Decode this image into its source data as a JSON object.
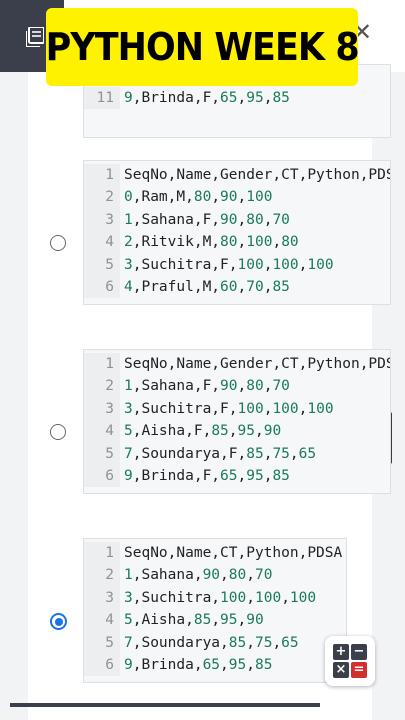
{
  "banner": {
    "title": "PYTHON WEEK 8"
  },
  "icons": {
    "document": "document-icon",
    "close": "close-icon",
    "calculator": "calculator-icon"
  },
  "colors": {
    "banner_bg": "#fff200",
    "radio_selected": "#1a73e8",
    "number": "#1a7a5a"
  },
  "blocks": [
    {
      "lines": [
        {
          "n": "11",
          "text": "9,Brinda,F,65,95,85"
        }
      ]
    },
    {
      "selected": false,
      "lines": [
        {
          "n": "1",
          "text": "SeqNo,Name,Gender,CT,Python,PDS"
        },
        {
          "n": "2",
          "text": "0,Ram,M,80,90,100"
        },
        {
          "n": "3",
          "text": "1,Sahana,F,90,80,70"
        },
        {
          "n": "4",
          "text": "2,Ritvik,M,80,100,80"
        },
        {
          "n": "5",
          "text": "3,Suchitra,F,100,100,100"
        },
        {
          "n": "6",
          "text": "4,Praful,M,60,70,85"
        }
      ]
    },
    {
      "selected": false,
      "lines": [
        {
          "n": "1",
          "text": "SeqNo,Name,Gender,CT,Python,PDS"
        },
        {
          "n": "2",
          "text": "1,Sahana,F,90,80,70"
        },
        {
          "n": "3",
          "text": "3,Suchitra,F,100,100,100"
        },
        {
          "n": "4",
          "text": "5,Aisha,F,85,95,90"
        },
        {
          "n": "5",
          "text": "7,Soundarya,F,85,75,65"
        },
        {
          "n": "6",
          "text": "9,Brinda,F,65,95,85"
        }
      ]
    },
    {
      "selected": true,
      "lines": [
        {
          "n": "1",
          "text": "SeqNo,Name,CT,Python,PDSA"
        },
        {
          "n": "2",
          "text": "1,Sahana,90,80,70"
        },
        {
          "n": "3",
          "text": "3,Suchitra,100,100,100"
        },
        {
          "n": "4",
          "text": "5,Aisha,85,95,90"
        },
        {
          "n": "5",
          "text": "7,Soundarya,85,75,65"
        },
        {
          "n": "6",
          "text": "9,Brinda,65,95,85"
        }
      ]
    }
  ],
  "calculator": {
    "plus": "+",
    "minus": "−",
    "times": "×",
    "equals": "="
  }
}
